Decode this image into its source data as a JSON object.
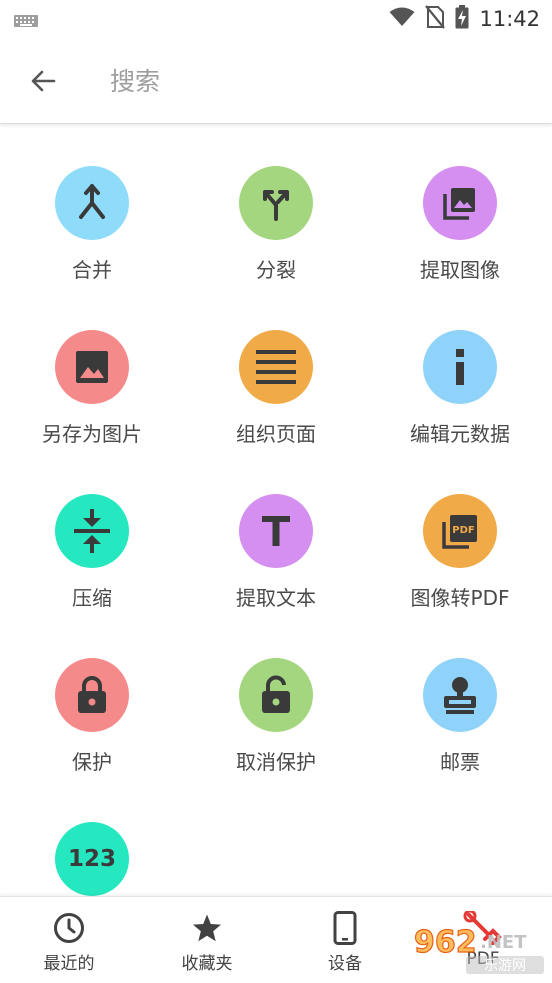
{
  "status_bar": {
    "time": "11:42"
  },
  "header": {
    "search_placeholder": "搜索"
  },
  "tools": [
    {
      "label": "合并",
      "icon": "merge-icon",
      "color": "#8fdcfa"
    },
    {
      "label": "分裂",
      "icon": "split-icon",
      "color": "#a4d67f"
    },
    {
      "label": "提取图像",
      "icon": "extract-images-icon",
      "color": "#d48ff0"
    },
    {
      "label": "另存为图片",
      "icon": "image-icon",
      "color": "#f58a8a"
    },
    {
      "label": "组织页面",
      "icon": "organize-pages-icon",
      "color": "#f0aa48"
    },
    {
      "label": "编辑元数据",
      "icon": "info-icon",
      "color": "#8fd3fa"
    },
    {
      "label": "压缩",
      "icon": "compress-icon",
      "color": "#25e8c0"
    },
    {
      "label": "提取文本",
      "icon": "text-icon",
      "color": "#d48ff0"
    },
    {
      "label": "图像转PDF",
      "icon": "image-to-pdf-icon",
      "color": "#f0aa48"
    },
    {
      "label": "保护",
      "icon": "lock-icon",
      "color": "#f58a8a"
    },
    {
      "label": "取消保护",
      "icon": "unlock-icon",
      "color": "#a4d67f"
    },
    {
      "label": "邮票",
      "icon": "stamp-icon",
      "color": "#8fd3fa"
    },
    {
      "label": "",
      "icon": "page-numbers-icon",
      "color": "#25e8c0",
      "icon_text": "123"
    }
  ],
  "bottom_nav": [
    {
      "label": "最近的",
      "icon": "clock-icon"
    },
    {
      "label": "收藏夹",
      "icon": "star-icon"
    },
    {
      "label": "设备",
      "icon": "phone-icon"
    },
    {
      "label": "PDF",
      "icon": "tools-icon"
    }
  ],
  "watermark": {
    "text": "962.NET",
    "subtext": "乐游网"
  },
  "colors": {
    "icon_glyph": "#424242",
    "accent_red": "#e53935"
  }
}
